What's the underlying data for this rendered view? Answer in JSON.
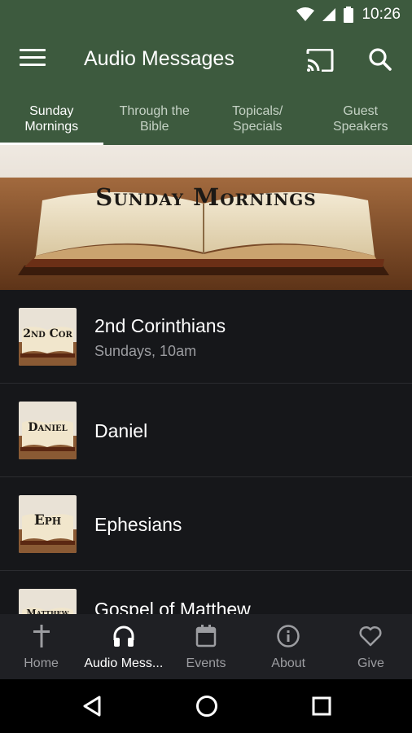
{
  "status_bar": {
    "time": "10:26"
  },
  "app_bar": {
    "title": "Audio Messages"
  },
  "tabs": [
    {
      "label": "Sunday\nMornings",
      "active": true
    },
    {
      "label": "Through the\nBible",
      "active": false
    },
    {
      "label": "Topicals/\nSpecials",
      "active": false
    },
    {
      "label": "Guest\nSpeakers",
      "active": false
    }
  ],
  "hero": {
    "title": "Sunday Mornings"
  },
  "list": {
    "items": [
      {
        "thumb_label": "2nd Cor",
        "title": "2nd Corinthians",
        "subtitle": "Sundays, 10am"
      },
      {
        "thumb_label": "Daniel",
        "title": "Daniel"
      },
      {
        "thumb_label": "Eph",
        "title": "Ephesians"
      },
      {
        "thumb_label": "Matthew",
        "title": "Gospel of Matthew"
      }
    ]
  },
  "bottom_nav": [
    {
      "label": "Home",
      "icon": "cross-icon"
    },
    {
      "label": "Audio Mess...",
      "icon": "headphones-icon",
      "active": true
    },
    {
      "label": "Events",
      "icon": "calendar-icon"
    },
    {
      "label": "About",
      "icon": "info-icon"
    },
    {
      "label": "Give",
      "icon": "heart-icon"
    }
  ],
  "colors": {
    "primary": "#3d5a3e",
    "background": "#16171a",
    "nav_background": "#1f2024"
  }
}
